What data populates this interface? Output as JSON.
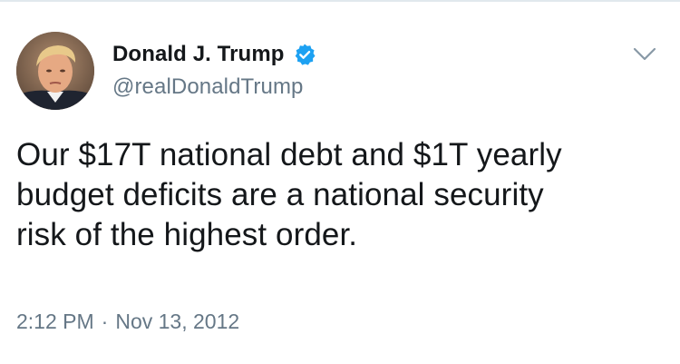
{
  "user": {
    "display_name": "Donald J. Trump",
    "handle": "@realDonaldTrump",
    "verified": true,
    "avatar_icon": "profile-photo"
  },
  "tweet": {
    "text": "Our $17T national debt and $1T yearly\nbudget deficits are a national security\nrisk of the highest order."
  },
  "meta": {
    "time": "2:12 PM",
    "separator": "·",
    "date": "Nov 13, 2012"
  },
  "icons": {
    "verified": "verified-badge-icon",
    "menu": "chevron-down-icon"
  },
  "colors": {
    "name": "#14171a",
    "secondary": "#657786",
    "verified": "#1da1f2",
    "border": "#e1e8ed"
  }
}
